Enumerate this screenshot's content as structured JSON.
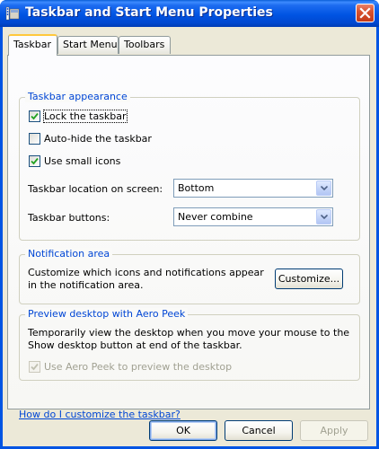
{
  "window": {
    "title": "Taskbar and Start Menu Properties"
  },
  "tabs": [
    {
      "label": "Taskbar",
      "active": true
    },
    {
      "label": "Start Menu",
      "active": false
    },
    {
      "label": "Toolbars",
      "active": false
    }
  ],
  "appearance": {
    "group_label": "Taskbar appearance",
    "lock_label": "Lock the taskbar",
    "lock_checked": true,
    "autohide_label": "Auto-hide the taskbar",
    "autohide_checked": false,
    "small_icons_label": "Use small icons",
    "small_icons_checked": true,
    "location_label": "Taskbar location on screen:",
    "location_value": "Bottom",
    "buttons_label": "Taskbar buttons:",
    "buttons_value": "Never combine"
  },
  "notification": {
    "group_label": "Notification area",
    "description": "Customize which icons and notifications appear in the notification area.",
    "customize_label": "Customize..."
  },
  "peek": {
    "group_label": "Preview desktop with Aero Peek",
    "description": "Temporarily view the desktop when you move your mouse to the Show desktop button at end of the taskbar.",
    "use_peek_label": "Use Aero Peek to preview the desktop",
    "use_peek_checked": true,
    "use_peek_enabled": false
  },
  "help_link": "How do I customize the taskbar?",
  "footer": {
    "ok_label": "OK",
    "cancel_label": "Cancel",
    "apply_label": "Apply"
  },
  "colors": {
    "title_bar": "#0054e3",
    "group_label": "#0046d5",
    "dialog_bg": "#ece9d8",
    "close_button": "#d9532f"
  }
}
